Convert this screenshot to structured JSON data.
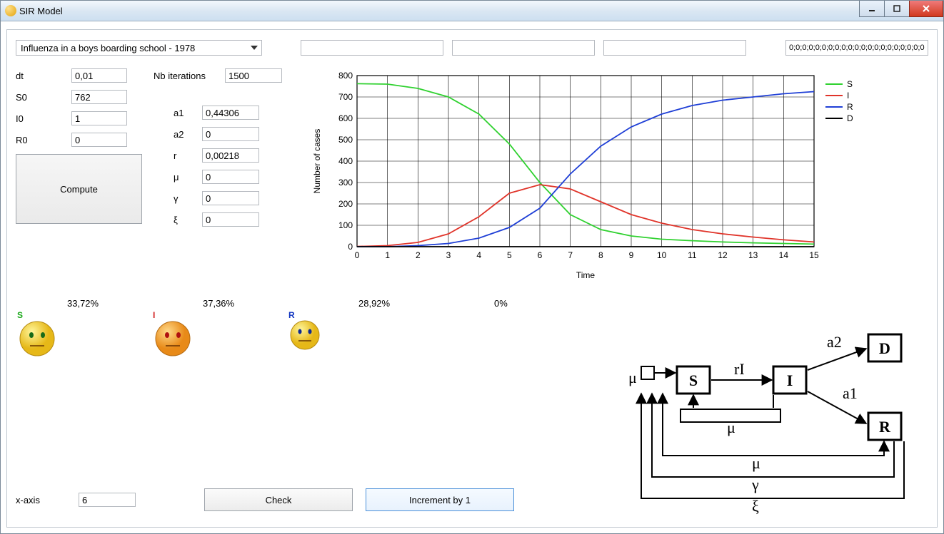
{
  "window": {
    "title": "SIR Model"
  },
  "winbuttons": {
    "min": "minimize",
    "max": "maximize",
    "close": "close"
  },
  "toprow": {
    "preset": "Influenza in a boys boarding school - 1978",
    "field1": "",
    "field2": "",
    "field3": "",
    "numbers": "0;0;0;0;0;0;0;0;0;0;0;0;0;0;0;0;0;0;0;0;0"
  },
  "params": {
    "left": {
      "dt": {
        "label": "dt",
        "value": "0,01"
      },
      "S0": {
        "label": "S0",
        "value": "762"
      },
      "I0": {
        "label": "I0",
        "value": "1"
      },
      "R0": {
        "label": "R0",
        "value": "0"
      }
    },
    "nb_iter": {
      "label": "Nb iterations",
      "value": "1500"
    },
    "right": {
      "a1": {
        "label": "a1",
        "value": "0,44306"
      },
      "a2": {
        "label": "a2",
        "value": "0"
      },
      "r": {
        "label": "r",
        "value": "0,00218"
      },
      "mu": {
        "label": "μ",
        "value": "0"
      },
      "gamma": {
        "label": "γ",
        "value": "0"
      },
      "xi": {
        "label": "ξ",
        "value": "0"
      }
    },
    "compute": "Compute"
  },
  "chart_data": {
    "type": "line",
    "title": "",
    "xlabel": "Time",
    "ylabel": "Number of cases",
    "xlim": [
      0,
      15
    ],
    "ylim": [
      0,
      800
    ],
    "xticks": [
      0,
      1,
      2,
      3,
      4,
      5,
      6,
      7,
      8,
      9,
      10,
      11,
      12,
      13,
      14,
      15
    ],
    "yticks": [
      0,
      100,
      200,
      300,
      400,
      500,
      600,
      700,
      800
    ],
    "legend": [
      "S",
      "I",
      "R",
      "D"
    ],
    "legend_colors": {
      "S": "#2fd12f",
      "I": "#e0342a",
      "R": "#1f3fd6",
      "D": "#000000"
    },
    "series": [
      {
        "name": "S",
        "color": "#2fd12f",
        "x": [
          0,
          1,
          2,
          3,
          4,
          5,
          6,
          7,
          8,
          9,
          10,
          11,
          12,
          13,
          14,
          15
        ],
        "y": [
          762,
          760,
          740,
          700,
          620,
          480,
          300,
          150,
          80,
          50,
          35,
          28,
          22,
          18,
          15,
          12
        ]
      },
      {
        "name": "I",
        "color": "#e0342a",
        "x": [
          0,
          1,
          2,
          3,
          4,
          5,
          6,
          7,
          8,
          9,
          10,
          11,
          12,
          13,
          14,
          15
        ],
        "y": [
          1,
          5,
          20,
          60,
          140,
          250,
          290,
          270,
          210,
          150,
          110,
          80,
          60,
          45,
          32,
          22
        ]
      },
      {
        "name": "R",
        "color": "#1f3fd6",
        "x": [
          0,
          1,
          2,
          3,
          4,
          5,
          6,
          7,
          8,
          9,
          10,
          11,
          12,
          13,
          14,
          15
        ],
        "y": [
          0,
          0,
          5,
          15,
          40,
          90,
          180,
          340,
          470,
          560,
          620,
          660,
          685,
          700,
          715,
          725
        ]
      },
      {
        "name": "D",
        "color": "#000000",
        "x": [
          0,
          1,
          2,
          3,
          4,
          5,
          6,
          7,
          8,
          9,
          10,
          11,
          12,
          13,
          14,
          15
        ],
        "y": [
          0,
          0,
          0,
          0,
          0,
          0,
          0,
          0,
          0,
          0,
          0,
          0,
          0,
          0,
          0,
          0
        ]
      }
    ]
  },
  "smileys": {
    "S": {
      "label": "S",
      "color": "#1aa81a",
      "pct": "33,72%"
    },
    "I": {
      "label": "I",
      "color": "#d12020",
      "pct": "37,36%"
    },
    "R": {
      "label": "R",
      "color": "#1034c0",
      "pct": "28,92%"
    },
    "D": {
      "label": "",
      "color": "#000",
      "pct": "0%"
    }
  },
  "diagram": {
    "boxes": {
      "S": "S",
      "I": "I",
      "R": "R",
      "D": "D"
    },
    "edges": {
      "mu": "μ",
      "rI": "rI",
      "a1": "a1",
      "a2": "a2",
      "gamma": "γ",
      "xi": "ξ"
    }
  },
  "bottom": {
    "xaxis_label": "x-axis",
    "xaxis_value": "6",
    "check": "Check",
    "increment": "Increment by 1"
  }
}
